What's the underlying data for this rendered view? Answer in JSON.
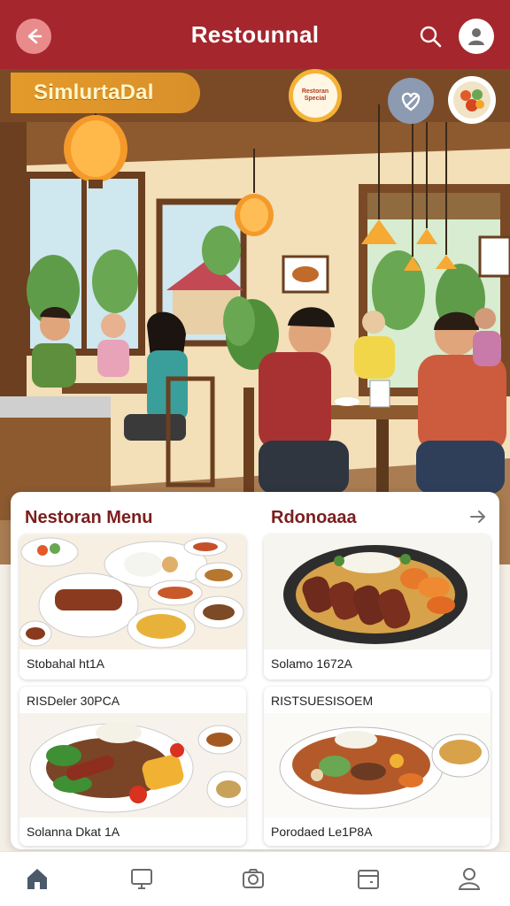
{
  "header": {
    "title": "Restounnal",
    "back_icon": "arrow-left-icon",
    "search_icon": "search-icon",
    "profile_icon": "user-icon"
  },
  "promo": {
    "label": "SimlurtaDal",
    "badge_text": "Restoran Special",
    "favorite_icon": "heart-icon"
  },
  "menu": {
    "title": "Nestoran Menu",
    "subtitle": "Rdonoaaa",
    "arrow_icon": "arrow-right-icon",
    "cards": [
      {
        "caption": "Stobahal ht1A"
      },
      {
        "caption": "Solamo 1672A"
      },
      {
        "heading": "RISDeler 30PCA",
        "caption": "Solanna Dkat 1A"
      },
      {
        "heading": "RISTSUESISOEM",
        "caption": "Porodaed Le1P8A"
      }
    ]
  },
  "nav": {
    "items": [
      {
        "icon": "home-icon"
      },
      {
        "icon": "monitor-icon"
      },
      {
        "icon": "camera-icon"
      },
      {
        "icon": "calendar-icon"
      },
      {
        "icon": "user-icon"
      }
    ]
  },
  "colors": {
    "header": "#a5262d",
    "accent": "#e49a2a",
    "title": "#7c1d1d"
  }
}
